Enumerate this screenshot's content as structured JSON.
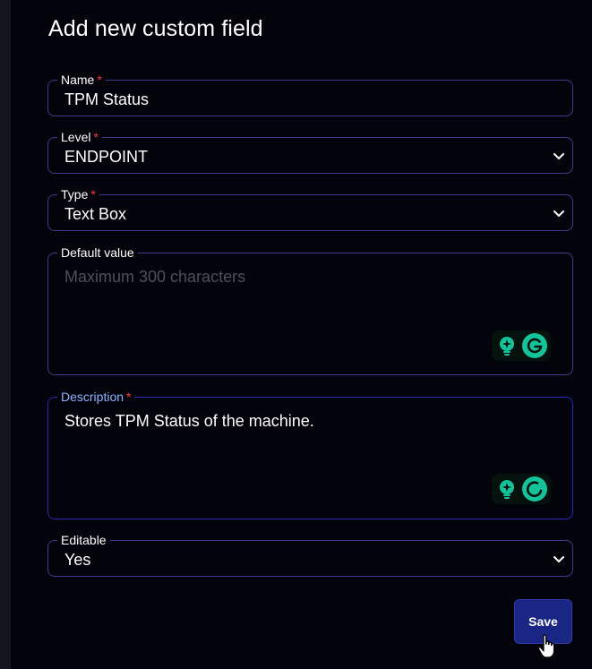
{
  "dialog": {
    "title": "Add new custom field"
  },
  "required_mark": "*",
  "fields": {
    "name": {
      "label": "Name",
      "value": "TPM Status",
      "required": true
    },
    "level": {
      "label": "Level",
      "value": "ENDPOINT",
      "required": true
    },
    "type": {
      "label": "Type",
      "value": "Text Box",
      "required": true
    },
    "default_value": {
      "label": "Default value",
      "placeholder": "Maximum 300 characters",
      "value": ""
    },
    "description": {
      "label": "Description",
      "value": "Stores TPM Status of the machine.",
      "required": true
    },
    "editable": {
      "label": "Editable",
      "value": "Yes"
    }
  },
  "actions": {
    "save_label": "Save"
  },
  "icons": {
    "chevron": "chevron-down-icon",
    "assist_bulb": "lightbulb-sparkle-icon",
    "grammar_g": "grammarly-icon",
    "cursor": "hand-pointer-cursor-icon"
  },
  "colors": {
    "background": "#03030b",
    "field_border": "#3d3c8c",
    "focus_border": "#2529b8",
    "required": "#ff3b3b",
    "focus_label": "#8fb3ff",
    "save_button": "#1a2683",
    "grammar_green": "#15c39a"
  }
}
